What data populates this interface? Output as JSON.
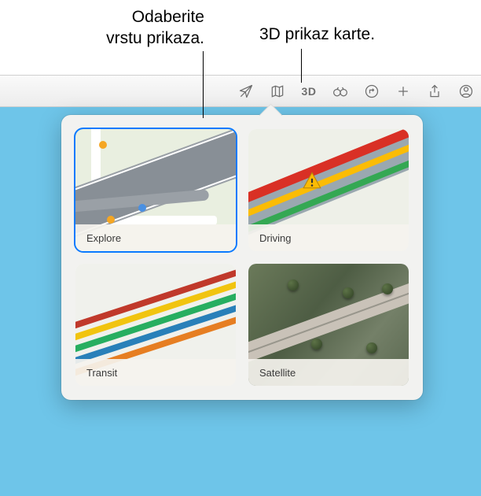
{
  "callouts": {
    "chooseView": "Odaberite\nvrstu prikaza.",
    "view3d": "3D prikaz karte."
  },
  "toolbar": {
    "label3d": "3D"
  },
  "mapModes": {
    "explore": {
      "label": "Explore"
    },
    "driving": {
      "label": "Driving"
    },
    "transit": {
      "label": "Transit"
    },
    "satellite": {
      "label": "Satellite"
    }
  }
}
